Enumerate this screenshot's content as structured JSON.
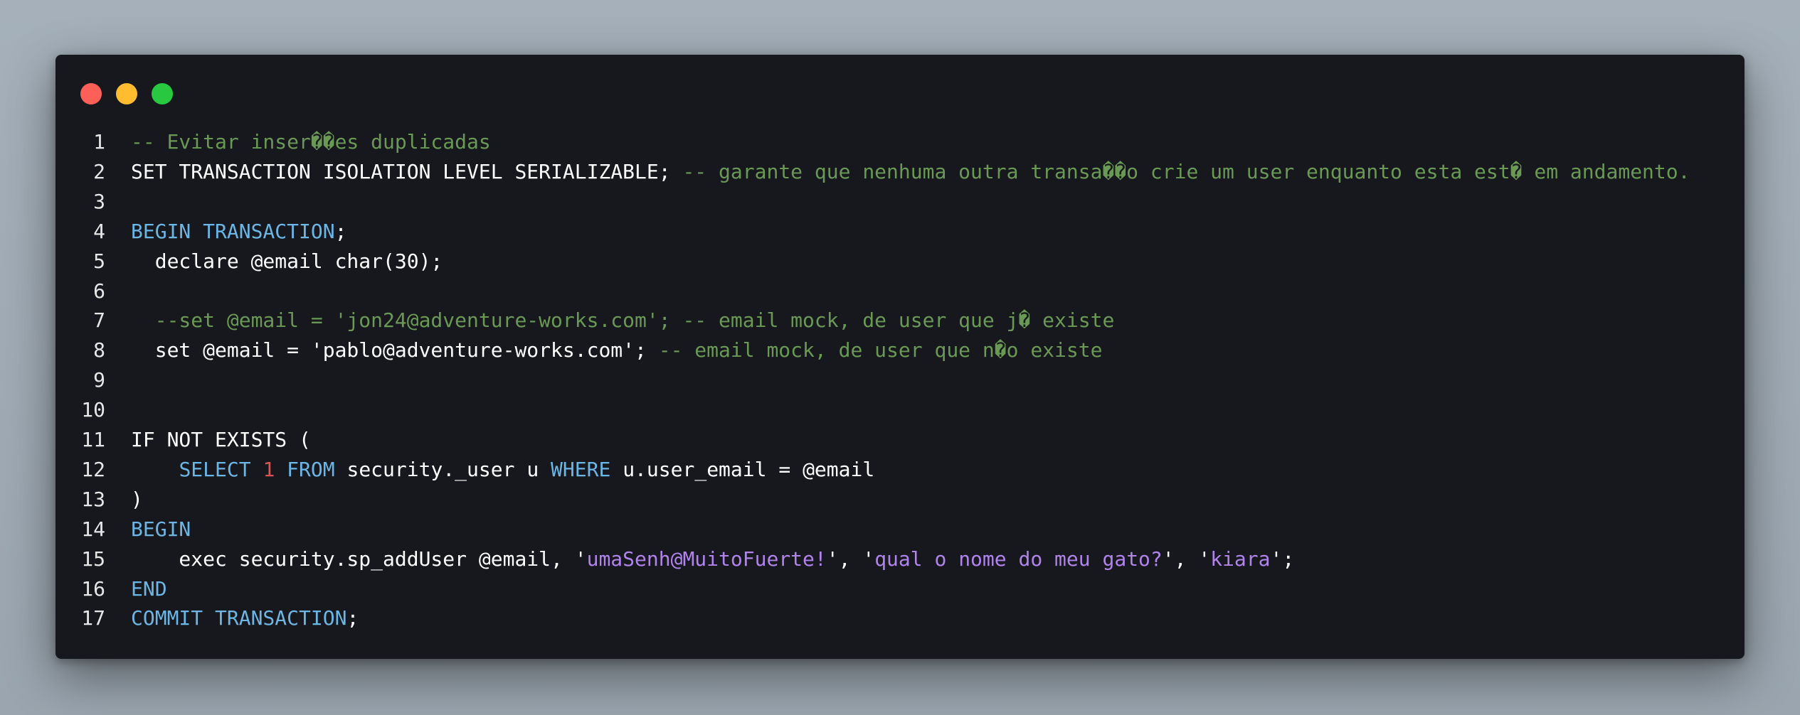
{
  "window": {
    "controls": [
      {
        "name": "close",
        "color": "#fe5f57"
      },
      {
        "name": "minimize",
        "color": "#febc2e"
      },
      {
        "name": "maximize",
        "color": "#28c840"
      }
    ]
  },
  "code": {
    "lines": [
      {
        "n": "1",
        "tokens": [
          {
            "t": "-- Evitar inser��es duplicadas",
            "c": "cmt"
          }
        ]
      },
      {
        "n": "2",
        "tokens": [
          {
            "t": "SET TRANSACTION ISOLATION LEVEL SERIALIZABLE; ",
            "c": "plain"
          },
          {
            "t": "-- garante que nenhuma outra transa��o crie um user enquanto esta est� em andamento.",
            "c": "cmt"
          }
        ]
      },
      {
        "n": "3",
        "tokens": []
      },
      {
        "n": "4",
        "tokens": [
          {
            "t": "BEGIN TRANSACTION",
            "c": "kw"
          },
          {
            "t": ";",
            "c": "plain"
          }
        ]
      },
      {
        "n": "5",
        "tokens": [
          {
            "t": "  declare @email char(30);",
            "c": "plain"
          }
        ]
      },
      {
        "n": "6",
        "tokens": []
      },
      {
        "n": "7",
        "tokens": [
          {
            "t": "  --set @email = 'jon24@adventure-works.com'; -- email mock, de user que j� existe",
            "c": "cmt"
          }
        ]
      },
      {
        "n": "8",
        "tokens": [
          {
            "t": "  set @email = 'pablo@adventure-works.com'; ",
            "c": "plain"
          },
          {
            "t": "-- email mock, de user que n�o existe",
            "c": "cmt"
          }
        ]
      },
      {
        "n": "9",
        "tokens": []
      },
      {
        "n": "10",
        "tokens": []
      },
      {
        "n": "11",
        "tokens": [
          {
            "t": "IF NOT EXISTS (",
            "c": "plain"
          }
        ]
      },
      {
        "n": "12",
        "tokens": [
          {
            "t": "    ",
            "c": "plain"
          },
          {
            "t": "SELECT",
            "c": "kw"
          },
          {
            "t": " ",
            "c": "plain"
          },
          {
            "t": "1",
            "c": "num"
          },
          {
            "t": " ",
            "c": "plain"
          },
          {
            "t": "FROM",
            "c": "kw"
          },
          {
            "t": " security._user u ",
            "c": "plain"
          },
          {
            "t": "WHERE",
            "c": "kw"
          },
          {
            "t": " u.user_email = @email",
            "c": "plain"
          }
        ]
      },
      {
        "n": "13",
        "tokens": [
          {
            "t": ")",
            "c": "plain"
          }
        ]
      },
      {
        "n": "14",
        "tokens": [
          {
            "t": "BEGIN",
            "c": "kw"
          }
        ]
      },
      {
        "n": "15",
        "tokens": [
          {
            "t": "    exec security.sp_addUser @email, '",
            "c": "plain"
          },
          {
            "t": "umaSenh@MuitoFuerte!",
            "c": "str"
          },
          {
            "t": "', '",
            "c": "plain"
          },
          {
            "t": "qual o nome do meu gato?",
            "c": "str"
          },
          {
            "t": "', '",
            "c": "plain"
          },
          {
            "t": "kiara",
            "c": "str"
          },
          {
            "t": "';",
            "c": "plain"
          }
        ]
      },
      {
        "n": "16",
        "tokens": [
          {
            "t": "END",
            "c": "kw"
          }
        ]
      },
      {
        "n": "17",
        "tokens": [
          {
            "t": "COMMIT TRANSACTION",
            "c": "kw"
          },
          {
            "t": ";",
            "c": "plain"
          }
        ]
      }
    ]
  }
}
